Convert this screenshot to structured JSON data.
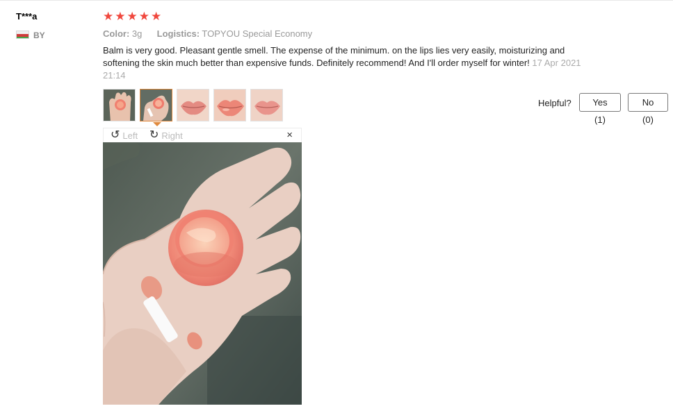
{
  "reviewer": {
    "name": "T***a",
    "country": "BY"
  },
  "rating": {
    "stars": 5,
    "max": 5,
    "star_glyph": "★",
    "star_color": "#f0473d"
  },
  "attributes": {
    "color_key": "Color:",
    "color_value": "3g",
    "logistics_key": "Logistics:",
    "logistics_value": "TOPYOU Special Economy"
  },
  "review": {
    "text": "Balm is very good. Pleasant gentle smell. The expense of the minimum. on the lips lies very easily, moisturizing and softening the skin much better than expensive funds. Definitely recommend! And I'll order myself for winter!",
    "date": "17 Apr 2021 21:14"
  },
  "thumbnails": [
    {
      "subject": "hand-with-balm",
      "selected": false
    },
    {
      "subject": "hand-with-balm",
      "selected": true
    },
    {
      "subject": "lips",
      "selected": false
    },
    {
      "subject": "lips",
      "selected": false
    },
    {
      "subject": "lips",
      "selected": false
    }
  ],
  "helpful": {
    "label": "Helpful?",
    "yes_label": "Yes (1)",
    "no_label": "No (0)"
  },
  "viewer": {
    "rotate_left_label": "Left",
    "rotate_right_label": "Right",
    "close_glyph": "×"
  },
  "colors": {
    "accent": "#e08a3e",
    "star": "#f0473d",
    "muted": "#999999"
  }
}
